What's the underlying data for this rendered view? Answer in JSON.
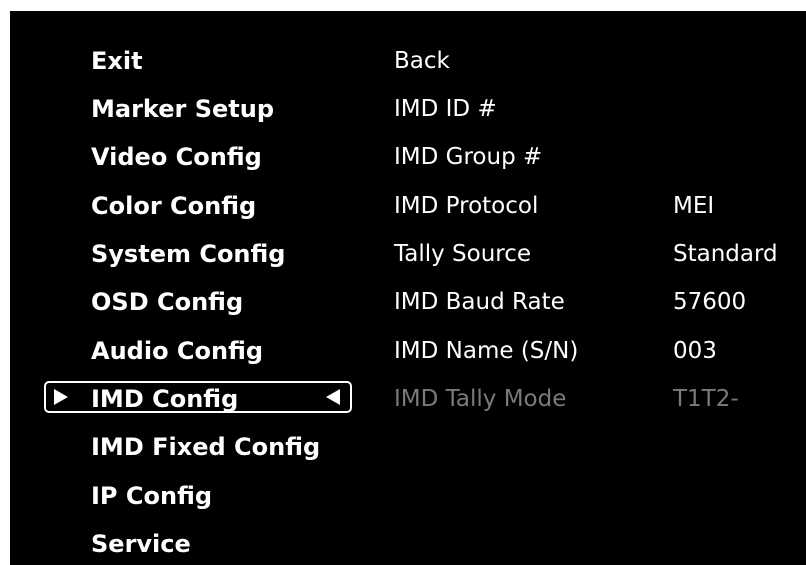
{
  "menu": {
    "items": [
      {
        "label": "Exit"
      },
      {
        "label": "Marker Setup"
      },
      {
        "label": "Video Config"
      },
      {
        "label": "Color Config"
      },
      {
        "label": "System Config"
      },
      {
        "label": "OSD Config"
      },
      {
        "label": "Audio Config"
      },
      {
        "label": "IMD Config"
      },
      {
        "label": "IMD Fixed Config"
      },
      {
        "label": "IP Config"
      },
      {
        "label": "Service"
      }
    ],
    "selected_label": "IMD Config"
  },
  "submenu": {
    "rows": [
      {
        "label": "Back",
        "value": ""
      },
      {
        "label": "IMD ID #",
        "value": ""
      },
      {
        "label": "IMD Group #",
        "value": ""
      },
      {
        "label": "IMD Protocol",
        "value": "MEI"
      },
      {
        "label": "Tally Source",
        "value": "Standard"
      },
      {
        "label": "IMD Baud Rate",
        "value": "57600"
      },
      {
        "label": "IMD Name (S/N)",
        "value": "003"
      },
      {
        "label": "IMD Tally Mode",
        "value": "T1T2-"
      }
    ]
  },
  "colors": {
    "background": "#000000",
    "text": "#ffffff",
    "disabled_text": "#7a7a7a"
  },
  "icons": {
    "selection_left": "triangle-right-icon",
    "selection_right": "triangle-left-icon"
  }
}
